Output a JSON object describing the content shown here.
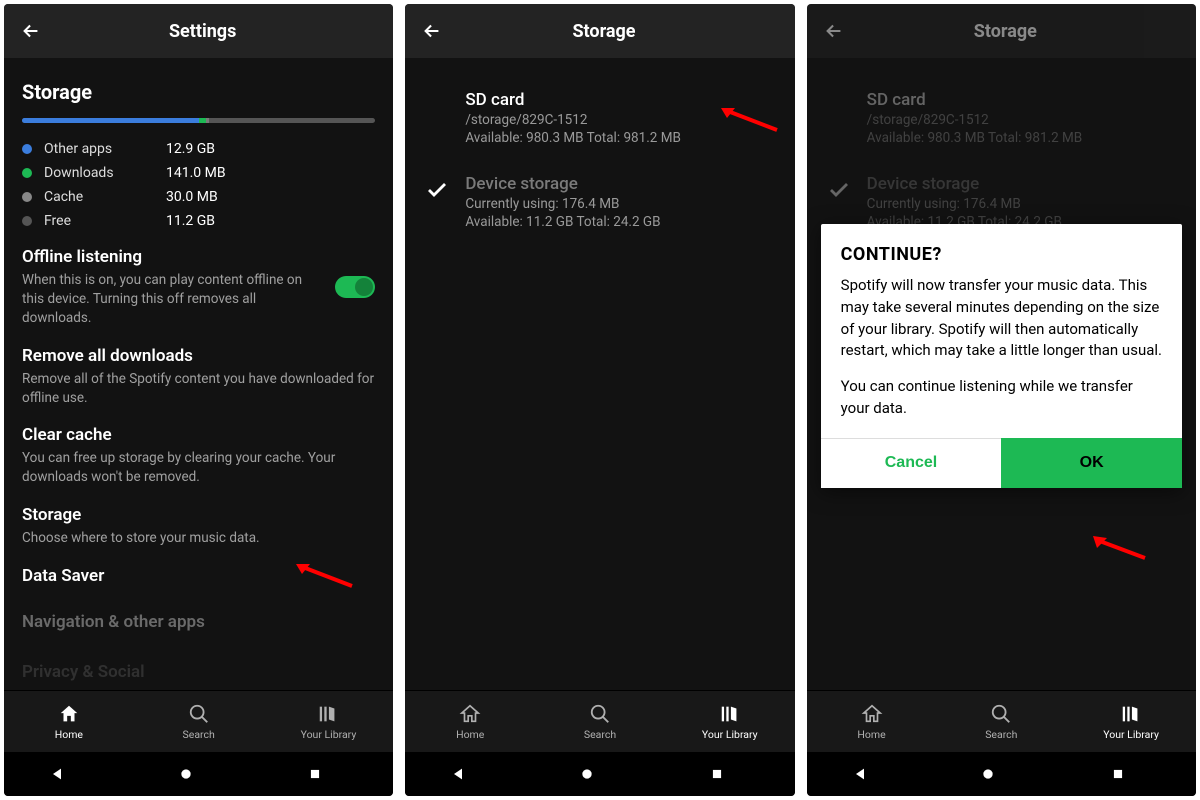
{
  "colors": {
    "blue": "#3b7ddd",
    "green": "#1db954",
    "grey": "#7a7a7a",
    "darkgrey": "#4a4a4a"
  },
  "panel1": {
    "title": "Settings",
    "section": "Storage",
    "bar": [
      {
        "pct": 50,
        "color": "#3b7ddd"
      },
      {
        "pct": 2,
        "color": "#1db954"
      },
      {
        "pct": 1,
        "color": "#7a7a7a"
      }
    ],
    "legend": [
      {
        "dot": "#3b7ddd",
        "label": "Other apps",
        "val": "12.9 GB"
      },
      {
        "dot": "#1db954",
        "label": "Downloads",
        "val": "141.0 MB"
      },
      {
        "dot": "#888888",
        "label": "Cache",
        "val": "30.0 MB"
      },
      {
        "dot": "#555555",
        "label": "Free",
        "val": "11.2 GB"
      }
    ],
    "offline": {
      "title": "Offline listening",
      "desc": "When this is on, you can play content offline on this device. Turning this off removes all downloads."
    },
    "remove": {
      "title": "Remove all downloads",
      "desc": "Remove all of the Spotify content you have downloaded for offline use."
    },
    "clear": {
      "title": "Clear cache",
      "desc": "You can free up storage by clearing your cache. Your downloads won't be removed."
    },
    "storage": {
      "title": "Storage",
      "desc": "Choose where to store your music data."
    },
    "datasaver": "Data Saver",
    "navapps": "Navigation & other apps",
    "privacy": "Privacy & Social"
  },
  "panel2": {
    "title": "Storage",
    "sd": {
      "title": "SD card",
      "path": "/storage/829C-1512",
      "avail": "Available: 980.3 MB Total: 981.2 MB"
    },
    "device": {
      "title": "Device storage",
      "using": "Currently using: 176.4 MB",
      "avail": "Available: 11.2 GB Total: 24.2 GB"
    }
  },
  "panel3": {
    "title": "Storage",
    "dialog": {
      "title": "CONTINUE?",
      "p1": "Spotify will now transfer your music data. This may take several minutes depending on the size of your library. Spotify will then automatically restart, which may take a little longer than usual.",
      "p2": "You can continue listening while we transfer your data.",
      "cancel": "Cancel",
      "ok": "OK"
    }
  },
  "tabs": {
    "home": "Home",
    "search": "Search",
    "library": "Your Library"
  }
}
